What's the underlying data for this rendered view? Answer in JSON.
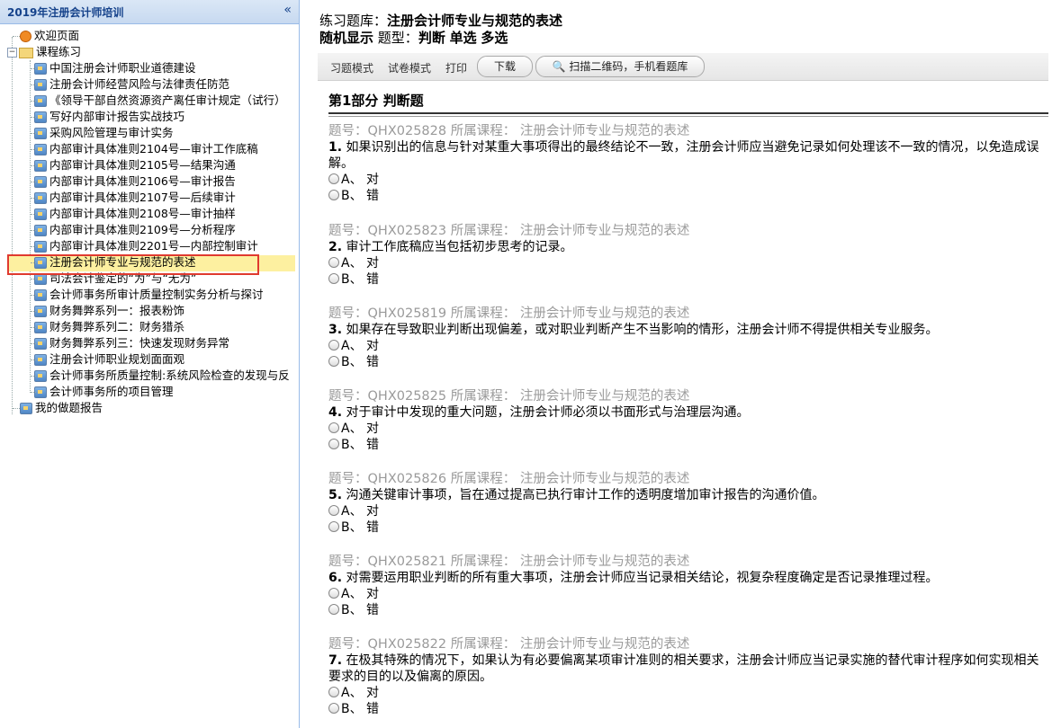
{
  "sidebar": {
    "title": "2019年注册会计师培训",
    "collapse_icon": "«",
    "welcome": "欢迎页面",
    "practice_folder": "课程练习",
    "courses": [
      "中国注册会计师职业道德建设",
      "注册会计师经营风险与法律责任防范",
      "《领导干部自然资源资产离任审计规定（试行）",
      "写好内部审计报告实战技巧",
      "采购风险管理与审计实务",
      "内部审计具体准则2104号—审计工作底稿",
      "内部审计具体准则2105号—结果沟通",
      "内部审计具体准则2106号—审计报告",
      "内部审计具体准则2107号—后续审计",
      "内部审计具体准则2108号—审计抽样",
      "内部审计具体准则2109号—分析程序",
      "内部审计具体准则2201号—内部控制审计",
      "注册会计师专业与规范的表述",
      "司法会计鉴定的“为”与“无为”",
      "会计师事务所审计质量控制实务分析与探讨",
      "财务舞弊系列一：报表粉饰",
      "财务舞弊系列二：财务猎杀",
      "财务舞弊系列三：快速发现财务异常",
      "注册会计师职业规划面面观",
      "会计师事务所质量控制:系统风险检查的发现与反",
      "会计师事务所的项目管理"
    ],
    "report": "我的做题报告"
  },
  "header": {
    "bank_label": "练习题库：",
    "bank_name": "注册会计师专业与规范的表述",
    "random_label": "随机显示",
    "type_label": "题型：",
    "type_judge": "判断",
    "type_single": "单选",
    "type_multi": "多选"
  },
  "toolbar": {
    "mode_practice": "习题模式",
    "mode_exam": "试卷模式",
    "print": "打印",
    "download": "下载",
    "scan": "扫描二维码，手机看题库"
  },
  "section_title": "第1部分 判断题",
  "option_a": "A、 对",
  "option_b": "B、 错",
  "questions": [
    {
      "meta": "题号：QHX025828 所属课程： 注册会计师专业与规范的表述",
      "num": "1.",
      "text": " 如果识别出的信息与针对某重大事项得出的最终结论不一致，注册会计师应当避免记录如何处理该不一致的情况，以免造成误解。"
    },
    {
      "meta": "题号：QHX025823 所属课程： 注册会计师专业与规范的表述",
      "num": "2.",
      "text": " 审计工作底稿应当包括初步思考的记录。"
    },
    {
      "meta": "题号：QHX025819 所属课程： 注册会计师专业与规范的表述",
      "num": "3.",
      "text": " 如果存在导致职业判断出现偏差，或对职业判断产生不当影响的情形，注册会计师不得提供相关专业服务。"
    },
    {
      "meta": "题号：QHX025825 所属课程： 注册会计师专业与规范的表述",
      "num": "4.",
      "text": " 对于审计中发现的重大问题，注册会计师必须以书面形式与治理层沟通。"
    },
    {
      "meta": "题号：QHX025826 所属课程： 注册会计师专业与规范的表述",
      "num": "5.",
      "text": " 沟通关键审计事项，旨在通过提高已执行审计工作的透明度增加审计报告的沟通价值。"
    },
    {
      "meta": "题号：QHX025821 所属课程： 注册会计师专业与规范的表述",
      "num": "6.",
      "text": " 对需要运用职业判断的所有重大事项，注册会计师应当记录相关结论，视复杂程度确定是否记录推理过程。"
    },
    {
      "meta": "题号：QHX025822 所属课程： 注册会计师专业与规范的表述",
      "num": "7.",
      "text": " 在极其特殊的情况下，如果认为有必要偏离某项审计准则的相关要求，注册会计师应当记录实施的替代审计程序如何实现相关要求的目的以及偏离的原因。"
    }
  ]
}
